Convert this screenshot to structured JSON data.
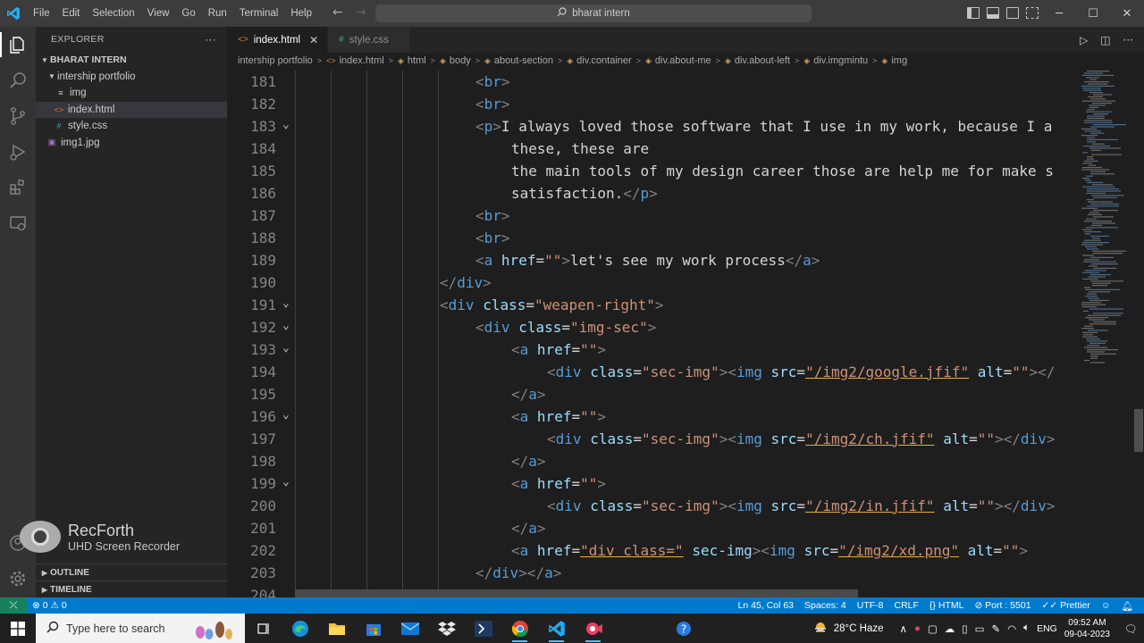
{
  "titlebar": {
    "menu": [
      "File",
      "Edit",
      "Selection",
      "View",
      "Go",
      "Run",
      "Terminal",
      "Help"
    ],
    "search_text": "bharat intern"
  },
  "sidebar": {
    "header": "EXPLORER",
    "more": "···",
    "root": "BHARAT INTERN",
    "folder": "intership portfolio",
    "items": [
      {
        "label": "img",
        "icon": "menu-icon"
      },
      {
        "label": "index.html",
        "icon": "html-icon"
      },
      {
        "label": "style.css",
        "icon": "css-icon"
      }
    ],
    "root_file": "img1.jpg",
    "outline": "OUTLINE",
    "timeline": "TIMELINE"
  },
  "watermark": {
    "title": "RecForth",
    "subtitle": "UHD Screen Recorder"
  },
  "tabs": [
    {
      "label": "index.html",
      "active": true
    },
    {
      "label": "style.css",
      "active": false
    }
  ],
  "breadcrumb": [
    "intership portfolio",
    "index.html",
    "html",
    "body",
    "about-section",
    "div.container",
    "div.about-me",
    "div.about-left",
    "div.imgmintu",
    "img"
  ],
  "editor": {
    "lines": [
      {
        "n": "181",
        "indent": 7
      },
      {
        "n": "182",
        "indent": 7
      },
      {
        "n": "183",
        "indent": 7,
        "fold": true
      },
      {
        "n": "184",
        "indent": 8
      },
      {
        "n": "185",
        "indent": 8
      },
      {
        "n": "186",
        "indent": 8
      },
      {
        "n": "187",
        "indent": 7
      },
      {
        "n": "188",
        "indent": 7
      },
      {
        "n": "189",
        "indent": 7
      },
      {
        "n": "190",
        "indent": 6
      },
      {
        "n": "191",
        "indent": 6,
        "fold": true
      },
      {
        "n": "192",
        "indent": 7,
        "fold": true
      },
      {
        "n": "193",
        "indent": 8,
        "fold": true
      },
      {
        "n": "194",
        "indent": 9
      },
      {
        "n": "195",
        "indent": 8
      },
      {
        "n": "196",
        "indent": 8,
        "fold": true
      },
      {
        "n": "197",
        "indent": 9
      },
      {
        "n": "198",
        "indent": 8
      },
      {
        "n": "199",
        "indent": 8,
        "fold": true
      },
      {
        "n": "200",
        "indent": 9
      },
      {
        "n": "201",
        "indent": 8
      },
      {
        "n": "202",
        "indent": 8
      },
      {
        "n": "203",
        "indent": 7
      },
      {
        "n": "204",
        "indent": 6
      }
    ],
    "text": {
      "l183": "I always loved those software that I use in my work, because I a",
      "l184": "these, these are",
      "l185": "the main tools of my design career those are help me for make s",
      "l186": "satisfaction.",
      "l189": "let's see my work process",
      "l191_val": "\"weapen-right\"",
      "l192_val": "\"img-sec\"",
      "l194_src": "\"/img2/google.jfif\"",
      "l197_src": "\"/img2/ch.jfif\"",
      "l200_src": "\"/img2/in.jfif\"",
      "l202_href": "\"div class=\"",
      "l202_src": "\"/img2/xd.png\""
    }
  },
  "statusbar": {
    "errors": "0",
    "warnings": "0",
    "position": "Ln 45, Col 63",
    "spaces": "Spaces: 4",
    "encoding": "UTF-8",
    "eol": "CRLF",
    "language": "HTML",
    "port": "Port : 5501",
    "formatter": "Prettier"
  },
  "taskbar": {
    "search_placeholder": "Type here to search",
    "weather": "28°C  Haze",
    "lang": "ENG",
    "time": "09:52 AM",
    "date": "09-04-2023"
  }
}
